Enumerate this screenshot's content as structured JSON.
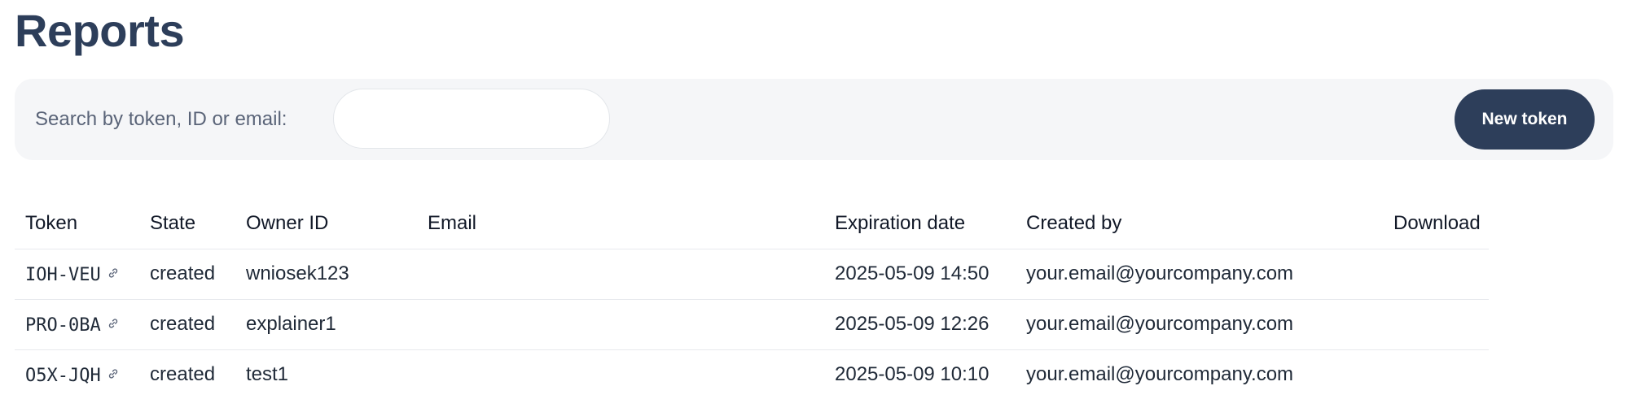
{
  "page": {
    "title": "Reports"
  },
  "search": {
    "label": "Search by token, ID or email:",
    "value": "",
    "placeholder": ""
  },
  "toolbar": {
    "new_token_label": "New token"
  },
  "table": {
    "headers": {
      "token": "Token",
      "state": "State",
      "owner_id": "Owner ID",
      "email": "Email",
      "expiration_date": "Expiration date",
      "created_by": "Created by",
      "download": "Download"
    },
    "rows": [
      {
        "token": "IOH-VEU",
        "state": "created",
        "owner_id": "wniosek123",
        "email": "",
        "expiration_date": "2025-05-09 14:50",
        "created_by": "your.email@yourcompany.com",
        "download": ""
      },
      {
        "token": "PRO-0BA",
        "state": "created",
        "owner_id": "explainer1",
        "email": "",
        "expiration_date": "2025-05-09 12:26",
        "created_by": "your.email@yourcompany.com",
        "download": ""
      },
      {
        "token": "O5X-JQH",
        "state": "created",
        "owner_id": "test1",
        "email": "",
        "expiration_date": "2025-05-09 10:10",
        "created_by": "your.email@yourcompany.com",
        "download": ""
      }
    ]
  },
  "icons": {
    "token_link": "link-icon"
  },
  "colors": {
    "title": "#2d3e5a",
    "accent": "#2d3e5a",
    "toolbar_bg": "#f5f6f8",
    "state_text": "#3a4d6e"
  }
}
